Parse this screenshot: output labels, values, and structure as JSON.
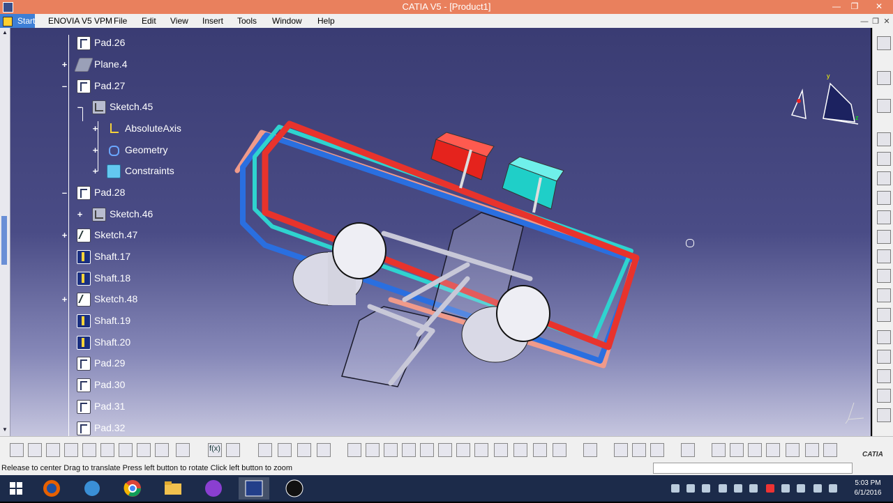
{
  "window": {
    "title": "CATIA V5 - [Product1]"
  },
  "menu": {
    "start": "Start",
    "items": [
      "ENOVIA V5 VPM",
      "File",
      "Edit",
      "View",
      "Insert",
      "Tools",
      "Window",
      "Help"
    ]
  },
  "tree": {
    "nodes": [
      {
        "label": "Pad.26",
        "icon": "pad-icon"
      },
      {
        "label": "Plane.4",
        "icon": "plane-icon"
      },
      {
        "label": "Pad.27",
        "icon": "pad-icon"
      },
      {
        "label": "Sketch.45",
        "icon": "sketch-icon"
      },
      {
        "label": "AbsoluteAxis",
        "icon": "absolute-axis-icon"
      },
      {
        "label": "Geometry",
        "icon": "geometry-icon"
      },
      {
        "label": "Constraints",
        "icon": "constraints-icon"
      },
      {
        "label": "Pad.28",
        "icon": "pad-icon"
      },
      {
        "label": "Sketch.46",
        "icon": "sketch-icon"
      },
      {
        "label": "Sketch.47",
        "icon": "sketch-icon"
      },
      {
        "label": "Shaft.17",
        "icon": "shaft-icon"
      },
      {
        "label": "Shaft.18",
        "icon": "shaft-icon"
      },
      {
        "label": "Sketch.48",
        "icon": "sketch-icon"
      },
      {
        "label": "Shaft.19",
        "icon": "shaft-icon"
      },
      {
        "label": "Shaft.20",
        "icon": "shaft-icon"
      },
      {
        "label": "Pad.29",
        "icon": "pad-icon"
      },
      {
        "label": "Pad.30",
        "icon": "pad-icon"
      },
      {
        "label": "Pad.31",
        "icon": "pad-icon"
      },
      {
        "label": "Pad.32",
        "icon": "pad-icon"
      }
    ]
  },
  "status": {
    "message": "Release to center  Drag to translate  Press left button to rotate  Click left button to zoom"
  },
  "clock": {
    "time": "5:03 PM",
    "date": "6/1/2016"
  },
  "brand": {
    "logo": "CATIA"
  },
  "colors": {
    "titlebar": "#e9805d",
    "viewport_top": "#3a3c73",
    "viewport_bottom": "#c6c6df",
    "hot_pipe": "#e8332c",
    "cold_pipe": "#2a6fe0",
    "cyan_pipe": "#2fd3cf"
  }
}
